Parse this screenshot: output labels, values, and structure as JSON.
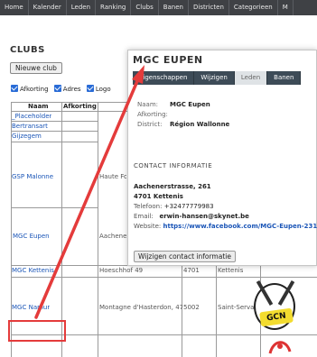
{
  "nav": {
    "items": [
      "Home",
      "Kalender",
      "Leden",
      "Ranking",
      "Clubs",
      "Banen",
      "Districten",
      "Categorieen",
      "M"
    ]
  },
  "page": {
    "title": "CLUBS",
    "new_club_button": "Nieuwe club"
  },
  "filters": [
    {
      "label": "Afkorting",
      "checked": true
    },
    {
      "label": "Adres",
      "checked": true
    },
    {
      "label": "Logo",
      "checked": true
    }
  ],
  "table": {
    "headers": [
      "Naam",
      "Afkorting"
    ],
    "rows": [
      {
        "naam": "_Placeholder"
      },
      {
        "naam": "Bertransart"
      },
      {
        "naam": "Gijzegem"
      },
      {
        "naam": "GSP Malonne",
        "adres": "Haute Fo"
      },
      {
        "naam": "MGC Eupen",
        "adres": "Aachener"
      },
      {
        "naam": "MGC Kettenis",
        "adres": "Hoeschhof 49",
        "postcode": "4701",
        "gemeente": "Kettenis"
      },
      {
        "naam": "MGC Namur",
        "adres": "Montagne d'Hasterdon, 47",
        "postcode": "5002",
        "gemeente": "Saint-Servais",
        "logo_text": "GCN"
      }
    ]
  },
  "popup": {
    "title": "MGC EUPEN",
    "tabs": [
      "Eigenschappen",
      "Wijzigen",
      "Leden",
      "Banen"
    ],
    "active_tab": "Leden",
    "details": [
      {
        "label": "Naam:",
        "value": "MGC Eupen"
      },
      {
        "label": "Afkorting:",
        "value": ""
      },
      {
        "label": "District:",
        "value": "Région Wallonne"
      }
    ],
    "contact_title": "CONTACT INFORMATIE",
    "address_line1": "Aachenerstrasse, 261",
    "address_line2": "4701 Kettenis",
    "telefoon_label": "Telefoon:",
    "telefoon": "+32477779983",
    "email_label": "Email:",
    "email": "erwin-hansen@skynet.be",
    "website_label": "Website:",
    "website": "https://www.facebook.com/MGC-Eupen-231",
    "edit_button": "Wijzigen contact informatie"
  },
  "colors": {
    "nav_bg": "#3f4145",
    "tab_bg": "#3d4b57",
    "link": "#1a55b7",
    "highlight": "#e43b3b",
    "checkbox": "#2a6cd6"
  }
}
